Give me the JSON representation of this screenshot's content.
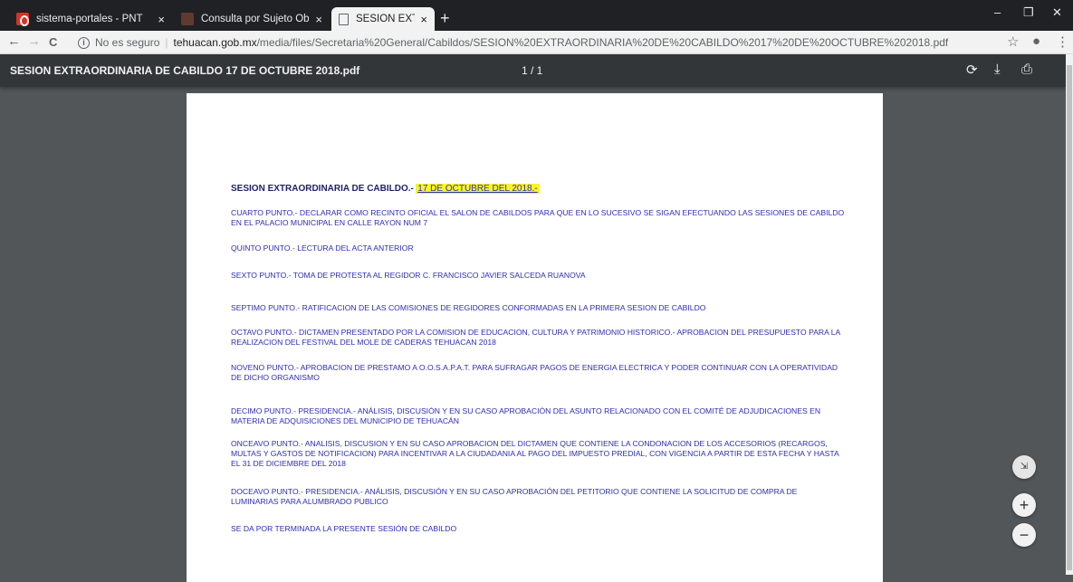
{
  "tabs": [
    {
      "title": "sistema-portales - PNT",
      "icon": "pnt-icon"
    },
    {
      "title": "Consulta por Sujeto Obligado",
      "icon": "sipot-icon"
    },
    {
      "title": "SESION EXTRAORDINARIA DE CA",
      "icon": "document-icon"
    }
  ],
  "omnibox": {
    "security": "No es seguro",
    "domain": "tehuacan.gob.mx",
    "path": "/media/files/Secretaria%20General/Cabildos/SESION%20EXTRAORDINARIA%20DE%20CABILDO%2017%20DE%20OCTUBRE%202018.pdf"
  },
  "pdf": {
    "filename": "SESION EXTRAORDINARIA DE CABILDO 17 DE OCTUBRE 2018.pdf",
    "page_indicator": "1 / 1"
  },
  "document": {
    "heading": "SESION EXTRAORDINARIA DE CABILDO.-",
    "heading_date": "17 DE OCTUBRE DEL 2018.-",
    "points": [
      "CUARTO PUNTO.- DECLARAR COMO RECINTO OFICIAL EL SALON DE CABILDOS PARA QUE EN LO SUCESIVO SE SIGAN EFECTUANDO LAS SESIONES DE CABILDO EN EL PALACIO MUNICIPAL EN CALLE RAYON NUM 7",
      "QUINTO PUNTO.- LECTURA DEL ACTA ANTERIOR",
      "SEXTO PUNTO.- TOMA DE PROTESTA AL REGIDOR C. FRANCISCO JAVIER SALCEDA RUANOVA",
      "SEPTIMO PUNTO.- RATIFICACION DE LAS COMISIONES DE REGIDORES CONFORMADAS EN LA PRIMERA SESION DE CABILDO",
      "OCTAVO PUNTO.- DICTAMEN PRESENTADO POR LA COMISION DE EDUCACION, CULTURA Y PATRIMONIO HISTORICO.- APROBACION DEL PRESUPUESTO PARA LA REALIZACION DEL FESTIVAL DEL MOLE DE CADERAS TEHUACAN 2018",
      "NOVENO PUNTO.- APROBACION DE PRESTAMO A O.O.S.A.P.A.T. PARA SUFRAGAR PAGOS DE ENERGIA ELECTRICA Y PODER CONTINUAR CON LA OPERATIVIDAD DE DICHO ORGANISMO",
      "DECIMO PUNTO.- PRESIDENCIA.- ANÁLISIS, DISCUSIÓN Y EN SU CASO APROBACIÓN DEL ASUNTO RELACIONADO CON EL COMITÉ DE ADJUDICACIONES EN MATERIA DE ADQUISICIONES DEL MUNICIPIO DE TEHUACÁN",
      "ONCEAVO PUNTO.- ANALISIS, DISCUSION Y EN SU CASO APROBACION DEL DICTAMEN QUE CONTIENE LA CONDONACION DE LOS ACCESORIOS (RECARGOS, MULTAS Y GASTOS DE NOTIFICACION) PARA INCENTIVAR A LA CIUDADANIA AL PAGO DEL IMPUESTO PREDIAL, CON VIGENCIA A PARTIR DE ESTA FECHA Y HASTA EL 31 DE DICIEMBRE DEL 2018",
      "DOCEAVO PUNTO.- PRESIDENCIA.- ANÁLISIS, DISCUSIÓN Y EN SU CASO APROBACIÓN DEL PETITORIO QUE CONTIENE LA SOLICITUD DE COMPRA DE LUMINARIAS PARA ALUMBRADO PUBLICO",
      "SE DA POR TERMINADA LA PRESENTE SESIÓN DE CABILDO"
    ]
  },
  "zoom": {
    "fit": "⇲",
    "in": "+",
    "out": "−"
  },
  "glyphs": {
    "close": "×",
    "new_tab": "+",
    "minimize": "–",
    "restore": "❐",
    "window_close": "✕",
    "back": "←",
    "forward": "→",
    "reload": "C",
    "info": "i",
    "star": "☆",
    "account": "●",
    "menu": "⋮",
    "rotate": "⟳",
    "download": "⤓",
    "print": "⎙"
  }
}
